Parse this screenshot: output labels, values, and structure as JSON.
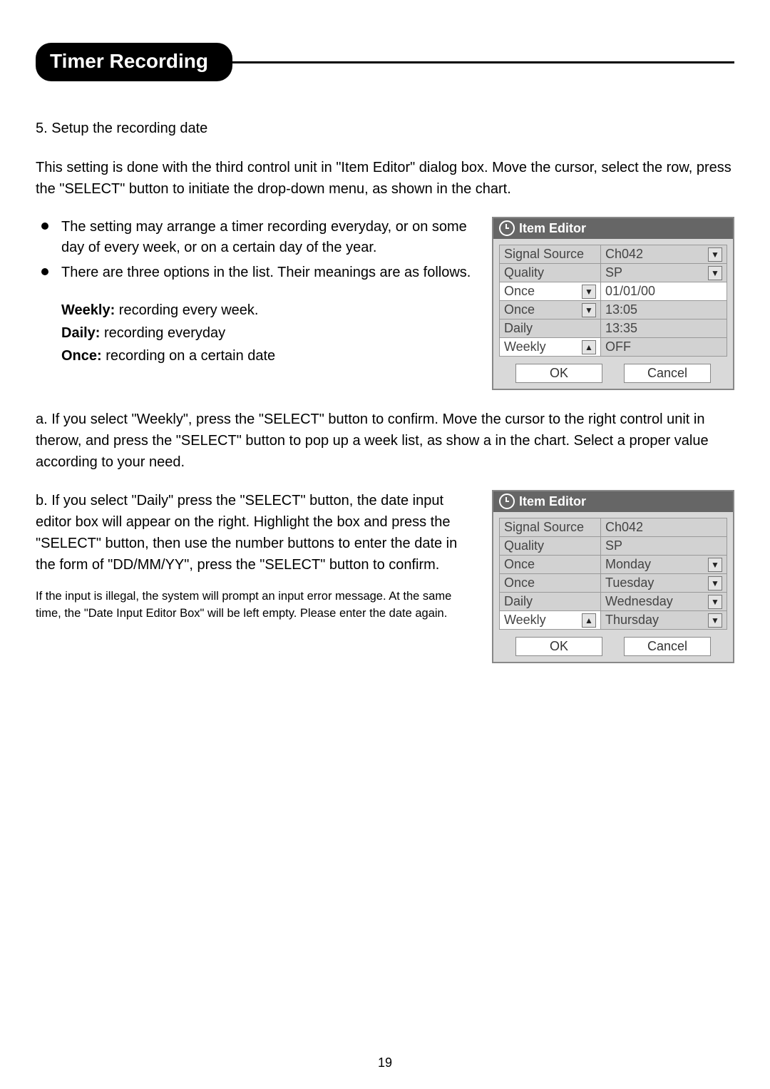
{
  "header": {
    "title": "Timer Recording"
  },
  "body": {
    "step_title_prefix": "5.",
    "step_sub": "Setup the recording date",
    "intro": "This setting is done with the third control unit in \"Item Editor\" dialog box. Move the cursor, select the row, press the \"SELECT\" button to initiate the drop-down menu, as shown in the chart.",
    "bullets": [
      "The setting may arrange a timer recording everyday, or on some day of every week, or on a certain day of the year.",
      "There are three options in the list. Their meanings are as follows."
    ],
    "defs": [
      {
        "term": "Weekly:",
        "desc": " recording every week."
      },
      {
        "term": "Daily:",
        "desc": " recording everyday"
      },
      {
        "term": "Once:",
        "desc": " recording on a certain date"
      }
    ],
    "para_a": "a. If you select \"Weekly\", press the \"SELECT\" button to confirm. Move the cursor to the right control unit in therow, and press the \"SELECT\" button to pop up a week list, as show a in the chart. Select a proper value according to your need.",
    "para_b": "b. If you select \"Daily\" press the \"SELECT\" button, the date input editor box will appear on the right. Highlight the box and press the \"SELECT\" button, then use the number buttons to enter the date in the form of \"DD/MM/YY\", press the \"SELECT\" button to confirm.",
    "note": "If the input is illegal, the system will prompt an input error message. At the same time, the \"Date Input Editor Box\" will be left empty. Please enter the date again."
  },
  "dialog1": {
    "title": "Item Editor",
    "rows": [
      {
        "left": "Signal Source",
        "right": "Ch042",
        "left_arrow": "",
        "right_arrow": "down"
      },
      {
        "left": "Quality",
        "right": "SP",
        "left_arrow": "",
        "right_arrow": "down"
      },
      {
        "left": "Once",
        "right": "01/01/00",
        "left_arrow": "down",
        "right_arrow": ""
      },
      {
        "left": "Once",
        "right": "13:05",
        "left_arrow": "down",
        "right_arrow": ""
      },
      {
        "left": "Daily",
        "right": "13:35",
        "left_arrow": "",
        "right_arrow": ""
      },
      {
        "left": "Weekly",
        "right": "OFF",
        "left_arrow": "up",
        "right_arrow": ""
      }
    ],
    "ok": "OK",
    "cancel": "Cancel"
  },
  "dialog2": {
    "title": "Item Editor",
    "rows": [
      {
        "left": "Signal Source",
        "right": "Ch042",
        "left_arrow": "",
        "right_arrow": ""
      },
      {
        "left": "Quality",
        "right": "SP",
        "left_arrow": "",
        "right_arrow": ""
      },
      {
        "left": "Once",
        "right": "Monday",
        "left_arrow": "",
        "right_arrow": "down"
      },
      {
        "left": "Once",
        "right": "Tuesday",
        "left_arrow": "",
        "right_arrow": "down"
      },
      {
        "left": "Daily",
        "right": "Wednesday",
        "left_arrow": "",
        "right_arrow": "down"
      },
      {
        "left": "Weekly",
        "right": "Thursday",
        "left_arrow": "up",
        "right_arrow": "down"
      }
    ],
    "ok": "OK",
    "cancel": "Cancel"
  },
  "page_number": "19"
}
